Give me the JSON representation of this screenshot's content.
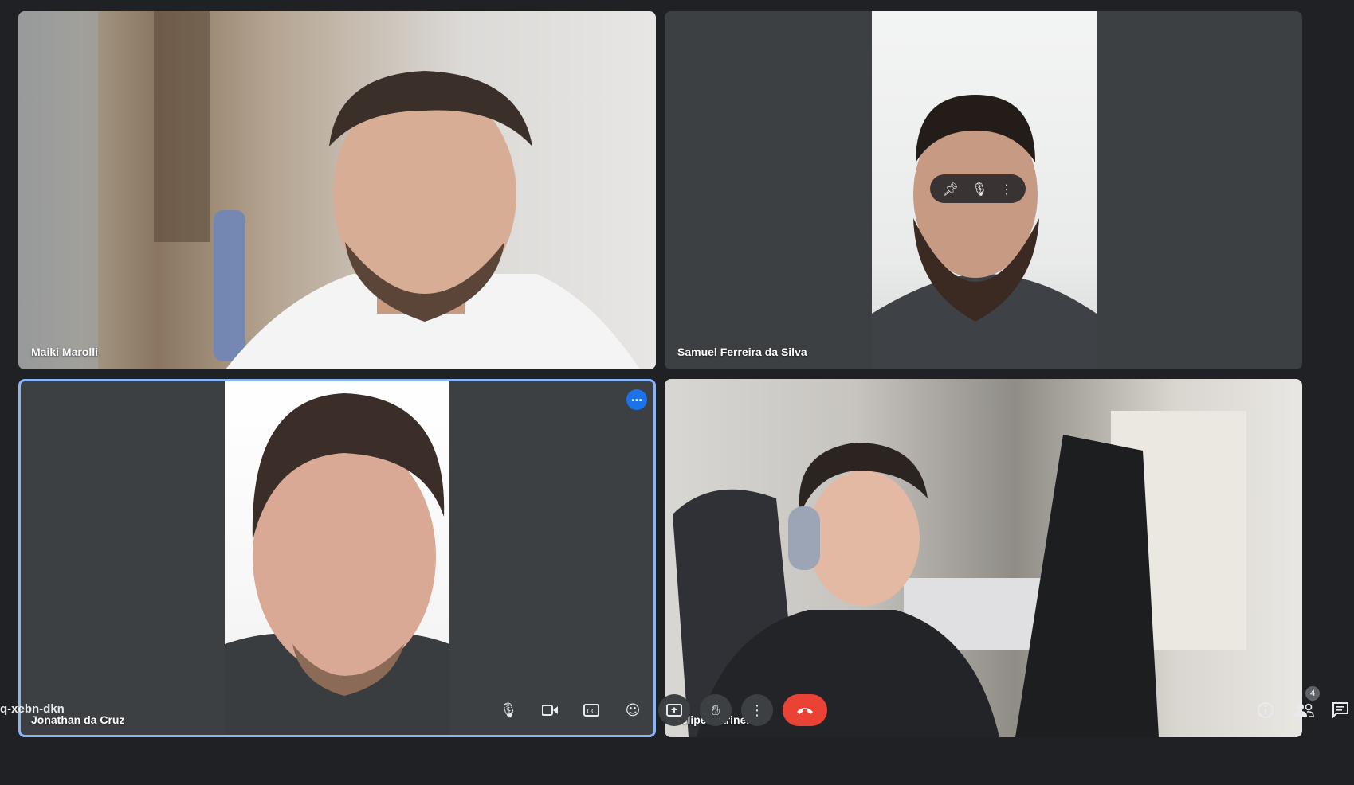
{
  "participants": [
    {
      "name": "Maiki Marolli"
    },
    {
      "name": "Samuel Ferreira da Silva"
    },
    {
      "name": "Jonathan da Cruz"
    },
    {
      "name": "felipe marinello"
    }
  ],
  "meeting": {
    "code": "q-xebn-dkn"
  },
  "controls": {
    "people_count": "4"
  },
  "colors": {
    "background": "#202124",
    "tile": "#3c4043",
    "active_border": "#8ab4f8",
    "end_call": "#ea4335",
    "accent": "#1a73e8"
  },
  "icons": {
    "mic": "mic-icon",
    "camera": "camera-icon",
    "captions": "captions-icon",
    "emoji": "emoji-icon",
    "present": "present-icon",
    "hand": "raise-hand-icon",
    "more": "more-vert-icon",
    "end": "call-end-icon",
    "info": "info-icon",
    "people": "people-icon",
    "chat": "chat-icon",
    "pin": "pin-icon"
  }
}
